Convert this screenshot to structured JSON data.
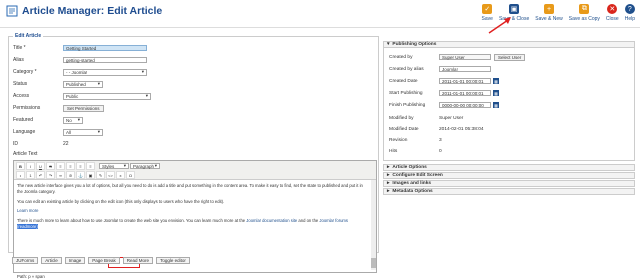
{
  "header": {
    "title": "Article Manager: Edit Article"
  },
  "toolbar": {
    "items": [
      {
        "label": "Save",
        "icon": "save-icon",
        "color": "#e89a1a"
      },
      {
        "label": "Save & Close",
        "icon": "save-close-icon",
        "color": "#1f4f8c"
      },
      {
        "label": "Save & New",
        "icon": "save-new-icon",
        "color": "#e89a1a"
      },
      {
        "label": "Save as Copy",
        "icon": "save-copy-icon",
        "color": "#e89a1a"
      },
      {
        "label": "Close",
        "icon": "close-icon",
        "color": "#d9261c"
      },
      {
        "label": "Help",
        "icon": "help-icon",
        "color": "#1f4f8c"
      }
    ]
  },
  "form": {
    "legend": "Edit Article",
    "fields": {
      "title_label": "Title *",
      "title_value": "Getting Started",
      "alias_label": "Alias",
      "alias_value": "getting-started",
      "category_label": "Category *",
      "category_value": "- - Joomla!",
      "status_label": "Status",
      "status_value": "Published",
      "access_label": "Access",
      "access_value": "Public",
      "permissions_label": "Permissions",
      "permissions_button": "Set Permissions",
      "featured_label": "Featured",
      "featured_value": "No",
      "language_label": "Language",
      "language_value": "All",
      "id_label": "ID",
      "id_value": "22",
      "text_label": "Article Text"
    },
    "editor": {
      "style_select": "Styles",
      "para_select": "Paragraph",
      "p1": "The new article interface gives you a lot of options, but all you need to do is add a title and put something in the content area. To make it easy to find, set the state to published and put it in the Joomla category.",
      "p2": "You can edit an existing article by clicking on the edit icon (this only displays to users who have the right to edit).",
      "learn_more": "Learn more",
      "p3a": "There is much more to learn about how to use Joomla! to create the web site you envision. You can learn much more at the ",
      "p3_link1": "Joomla! documentation site",
      "p3b": " and on the ",
      "p3_link2": "Joomla! forums",
      "p3_selected": "(readmore)",
      "path": "Path: p » span"
    },
    "editor_buttons": [
      "JUForms",
      "Article",
      "Image",
      "Page Break",
      "Read More",
      "Toggle editor"
    ]
  },
  "publishing": {
    "title": "Publishing Options",
    "created_by_label": "Created by",
    "created_by_value": "Super User",
    "select_user": "Select User",
    "alias_label": "Created by alias",
    "alias_value": "Joomla!",
    "created_date_label": "Created Date",
    "created_date_value": "2011-01-01 00:00:01",
    "start_label": "Start Publishing",
    "start_value": "2011-01-01 00:00:01",
    "finish_label": "Finish Publishing",
    "finish_value": "0000-00-00 00:00:00",
    "modified_by_label": "Modified by",
    "modified_by_value": "Super User",
    "modified_date_label": "Modified Date",
    "modified_date_value": "2014-02-01 05:38:04",
    "revision_label": "Revision",
    "revision_value": "3",
    "hits_label": "Hits",
    "hits_value": "0"
  },
  "panels": [
    "Article Options",
    "Configure Edit Screen",
    "Images and links",
    "Metadata Options"
  ]
}
